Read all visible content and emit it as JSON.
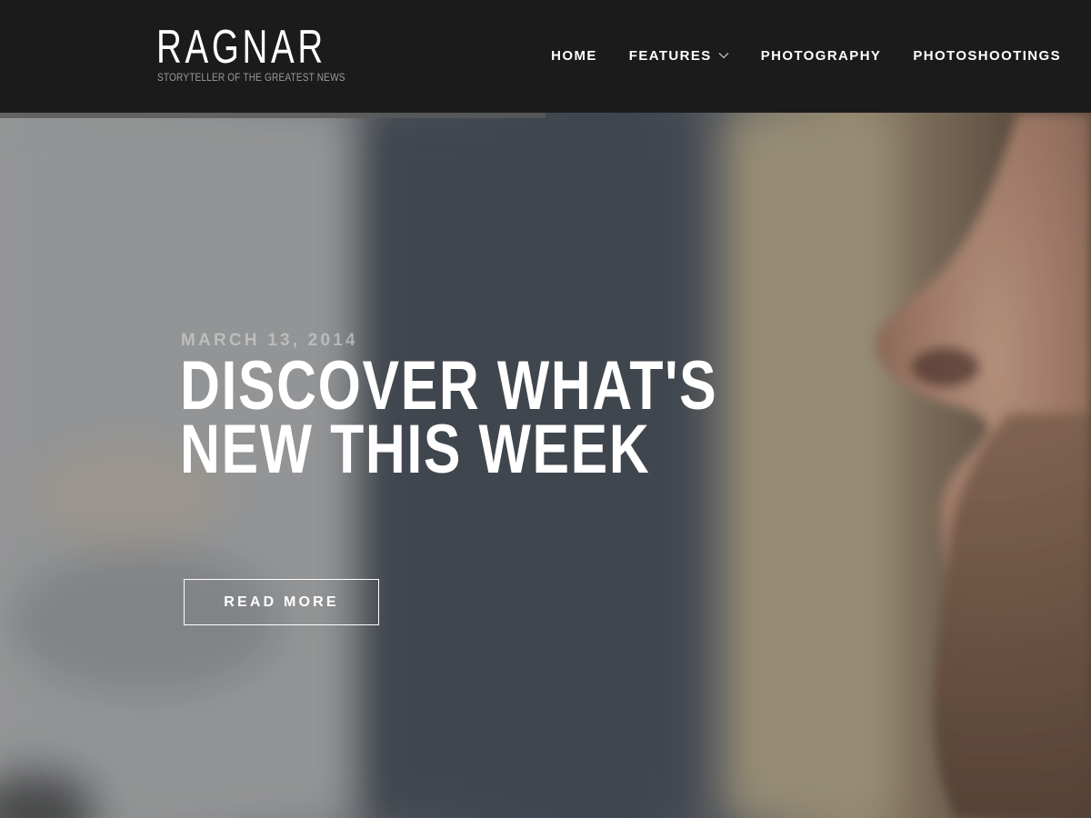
{
  "site": {
    "name": "RAGNAR",
    "tagline": "STORYTELLER OF THE GREATEST NEWS"
  },
  "nav": {
    "items": [
      {
        "label": "HOME",
        "icon": null
      },
      {
        "label": "FEATURES",
        "icon": "chevron-down-icon"
      },
      {
        "label": "PHOTOGRAPHY",
        "icon": null
      },
      {
        "label": "PHOTOSHOOTINGS",
        "icon": null
      }
    ]
  },
  "reading_progress": 0.5,
  "hero": {
    "date": "MARCH 13, 2014",
    "title": "DISCOVER WHAT'S NEW THIS WEEK",
    "button_label": "READ MORE"
  },
  "colors": {
    "header_bg": "#1b1b1b",
    "text": "#ffffff",
    "tagline": "#9a9a9a",
    "date": "#d7d7d7"
  }
}
